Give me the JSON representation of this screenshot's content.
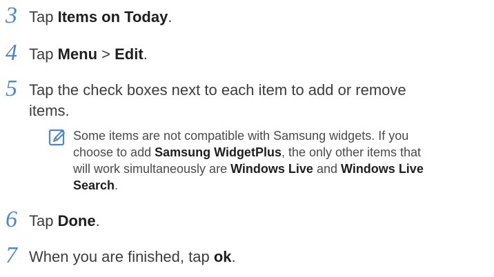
{
  "steps": [
    {
      "num": "3",
      "parts": [
        "Tap ",
        "Items on Today",
        "."
      ]
    },
    {
      "num": "4",
      "parts": [
        "Tap ",
        "Menu",
        " > ",
        "Edit",
        "."
      ]
    },
    {
      "num": "5",
      "line1": "Tap the check boxes next to each item to add or remove",
      "line2": "items."
    },
    {
      "num": "6",
      "parts": [
        "Tap ",
        "Done",
        "."
      ]
    },
    {
      "num": "7",
      "parts": [
        "When you are finished, tap ",
        "ok",
        "."
      ]
    }
  ],
  "note": {
    "icon": "note-pencil-icon",
    "line1": "Some items are not compatible with Samsung widgets. If you",
    "line2_a": "choose to add ",
    "line2_b": "Samsung WidgetPlus",
    "line2_c": ", the only other items that",
    "line3_a": "will work simultaneously are ",
    "line3_b": "Windows Live",
    "line3_c": " and ",
    "line3_d": "Windows Live",
    "line4_a": "Search",
    "line4_b": "."
  },
  "colors": {
    "step_number": "#4f86c6",
    "text": "#3c3c3c"
  }
}
